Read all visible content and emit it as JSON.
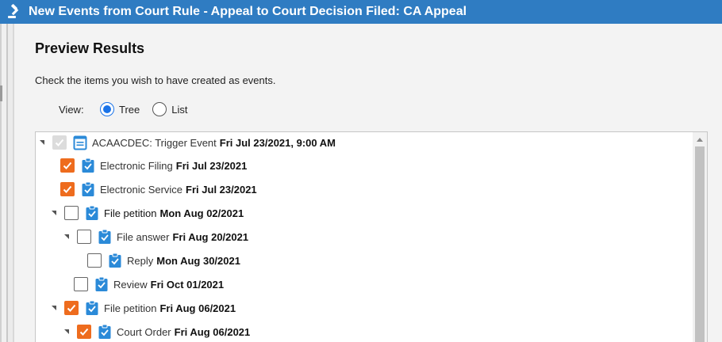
{
  "window": {
    "title": "New Events from Court Rule - Appeal to Court Decision Filed: CA Appeal"
  },
  "preview": {
    "heading": "Preview Results",
    "instructions": "Check the items you wish to have created as events."
  },
  "view": {
    "label": "View:",
    "options": [
      {
        "label": "Tree",
        "selected": true
      },
      {
        "label": "List",
        "selected": false
      }
    ]
  },
  "tree": {
    "items": [
      {
        "label": "ACAACDEC: Trigger Event",
        "date": "Fri Jul 23/2021, 9:00 AM",
        "checked": "indeterminate",
        "expander": true,
        "icon": "calendar-list-icon"
      },
      {
        "label": "Electronic Filing",
        "date": "Fri Jul 23/2021",
        "checked": true,
        "expander": false,
        "icon": "clipboard-check-icon"
      },
      {
        "label": "Electronic Service",
        "date": "Fri Jul 23/2021",
        "checked": true,
        "expander": false,
        "icon": "clipboard-check-icon"
      },
      {
        "label": "File petition",
        "date": "Mon Aug 02/2021",
        "checked": false,
        "expander": true,
        "icon": "clipboard-check-icon"
      },
      {
        "label": "File answer",
        "date": "Fri Aug 20/2021",
        "checked": false,
        "expander": true,
        "icon": "clipboard-check-icon"
      },
      {
        "label": "Reply",
        "date": "Mon Aug 30/2021",
        "checked": false,
        "expander": false,
        "icon": "clipboard-check-icon"
      },
      {
        "label": "Review",
        "date": "Fri Oct 01/2021",
        "checked": false,
        "expander": false,
        "icon": "clipboard-check-icon"
      },
      {
        "label": "File petition",
        "date": "Fri Aug 06/2021",
        "checked": true,
        "expander": true,
        "icon": "clipboard-check-icon"
      },
      {
        "label": "Court Order",
        "date": "Fri Aug 06/2021",
        "checked": true,
        "expander": true,
        "icon": "clipboard-check-icon"
      }
    ]
  },
  "colors": {
    "titlebar": "#2f7cc2",
    "checked": "#ee6c1e",
    "accent": "#1a73e8",
    "icon": "#2b8ad8"
  }
}
